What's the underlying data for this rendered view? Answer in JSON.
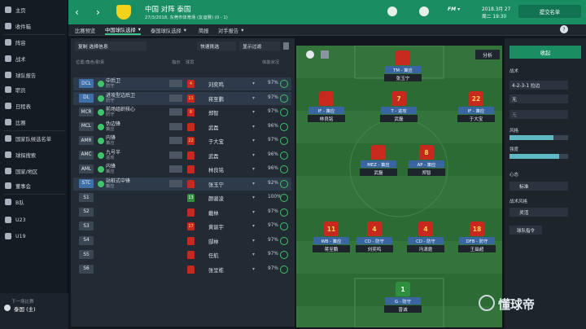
{
  "sidebar": {
    "items": [
      "主页",
      "收件箱",
      "阵容",
      "战术",
      "球队报告",
      "职员",
      "日程表",
      "比赛",
      "国家队候选名单",
      "球探搜索",
      "国家/地区",
      "董事会",
      "B队",
      "U23",
      "U19"
    ],
    "footer_small": "下一场比赛",
    "footer_team": "泰国 (主)"
  },
  "header": {
    "title": "中国 对阵 泰国",
    "subtitle": "27/3/2018, 东莞市体育场 (友谊赛) (0 - 1)",
    "date": "2018.3月 27",
    "day_time": "周二 19:30",
    "submit": "提交名单"
  },
  "tabs": [
    "比赛预览",
    "中国球队选择",
    "泰国球队选择",
    "简报",
    "对手报告"
  ],
  "left": {
    "menu": "复制 选择信息",
    "quick": "快速挑选",
    "display": "显示过滤",
    "col_pos": "位置/角色/职责",
    "col_idx": "指示",
    "col_player": "球员",
    "col_fit": "体能状况"
  },
  "rows": [
    {
      "pos": "DCL",
      "role": "中后卫",
      "duty": "防守",
      "num": "4",
      "name": "刘奕鸣",
      "pct": "97%"
    },
    {
      "pos": "DL",
      "role": "进攻型边后卫",
      "duty": "防守",
      "num": "11",
      "name": "蒋至鹏",
      "pct": "97%"
    },
    {
      "pos": "MCR",
      "role": "前场组织核心",
      "duty": "防守",
      "num": "8",
      "name": "郑智",
      "pct": "97%"
    },
    {
      "pos": "MCL",
      "role": "伪边锋",
      "duty": "策应",
      "num": "",
      "name": "武磊",
      "pct": "96%"
    },
    {
      "pos": "AMR",
      "role": "内锋",
      "duty": "策应",
      "num": "22",
      "name": "于大宝",
      "pct": "97%"
    },
    {
      "pos": "AMC",
      "role": "九号半",
      "duty": "进攻",
      "num": "",
      "name": "武磊",
      "pct": "96%"
    },
    {
      "pos": "AML",
      "role": "内锋",
      "duty": "策应",
      "num": "",
      "name": "林良铭",
      "pct": "96%"
    },
    {
      "pos": "STC",
      "role": "站桩式中锋",
      "duty": "策应",
      "num": "",
      "name": "张玉宁",
      "pct": "92%"
    },
    {
      "pos": "S1",
      "role": "",
      "duty": "",
      "num": "13",
      "name": "颜骏凌",
      "pct": "100%"
    },
    {
      "pos": "S2",
      "role": "",
      "duty": "",
      "num": "",
      "name": "戴林",
      "pct": "97%"
    },
    {
      "pos": "S3",
      "role": "",
      "duty": "",
      "num": "17",
      "name": "黄诞宇",
      "pct": "97%"
    },
    {
      "pos": "S4",
      "role": "",
      "duty": "",
      "num": "",
      "name": "郜林",
      "pct": "97%"
    },
    {
      "pos": "S5",
      "role": "",
      "duty": "",
      "num": "",
      "name": "任航",
      "pct": "97%"
    },
    {
      "pos": "S6",
      "role": "",
      "duty": "",
      "num": "",
      "name": "张呈栋",
      "pct": "97%"
    }
  ],
  "pitch": {
    "analysis": "分析",
    "players": [
      {
        "num": "",
        "role": "TM - 策应",
        "name": "张玉宁"
      },
      {
        "num": "",
        "role": "IF - 策应",
        "name": "林良铭"
      },
      {
        "num": "7",
        "role": "T - 进攻",
        "name": "武磊"
      },
      {
        "num": "22",
        "role": "IF - 策应",
        "name": "于大宝"
      },
      {
        "num": "",
        "role": "MEZ - 策应",
        "name": "武磊"
      },
      {
        "num": "8",
        "role": "AP - 策应",
        "name": "郑智"
      },
      {
        "num": "11",
        "role": "WB - 策应",
        "name": "蒋至鹏"
      },
      {
        "num": "4",
        "role": "CD - 防守",
        "name": "刘奕鸣"
      },
      {
        "num": "4",
        "role": "CD - 防守",
        "name": "冯潇霆"
      },
      {
        "num": "18",
        "role": "DFB - 防守",
        "name": "王燊超"
      },
      {
        "num": "1",
        "role": "G - 防守",
        "name": "曾诚"
      }
    ]
  },
  "right": {
    "collapse": "收起",
    "tactics": "战术",
    "formation": "4-2-3-1 拉边",
    "slot2": "无",
    "slot3": "无",
    "style_label": "风格",
    "fluid_label": "强度",
    "mentality_label": "心态",
    "mentality": "标准",
    "style2_label": "战术风格",
    "style2": "灵活",
    "instr": "球队指令"
  },
  "watermark": "懂球帝",
  "colors": {
    "header": "#1a8d63",
    "pitch": "#2d6b34",
    "accent": "#38c48b",
    "shirt": "#c8291e"
  }
}
